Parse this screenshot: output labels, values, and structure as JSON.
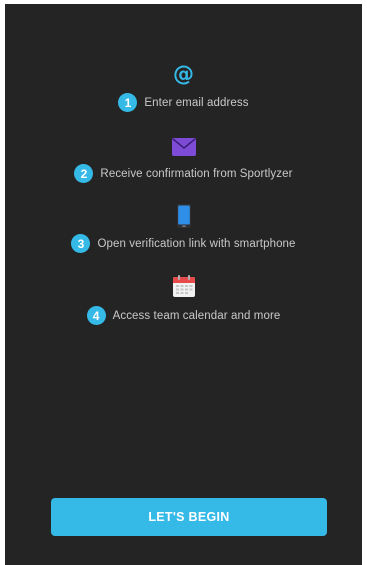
{
  "colors": {
    "background": "#242424",
    "accent": "#35b9e7",
    "text": "#c9c9c9",
    "envelope": "#7d4bd6",
    "calendar_red": "#e64a4a"
  },
  "steps": [
    {
      "number": "1",
      "text": "Enter email address",
      "icon": "at-icon"
    },
    {
      "number": "2",
      "text": "Receive confirmation from Sportlyzer",
      "icon": "envelope-icon"
    },
    {
      "number": "3",
      "text": "Open verification link with smartphone",
      "icon": "smartphone-icon"
    },
    {
      "number": "4",
      "text": "Access team calendar and more",
      "icon": "calendar-icon"
    }
  ],
  "button": {
    "label": "LET'S BEGIN"
  }
}
